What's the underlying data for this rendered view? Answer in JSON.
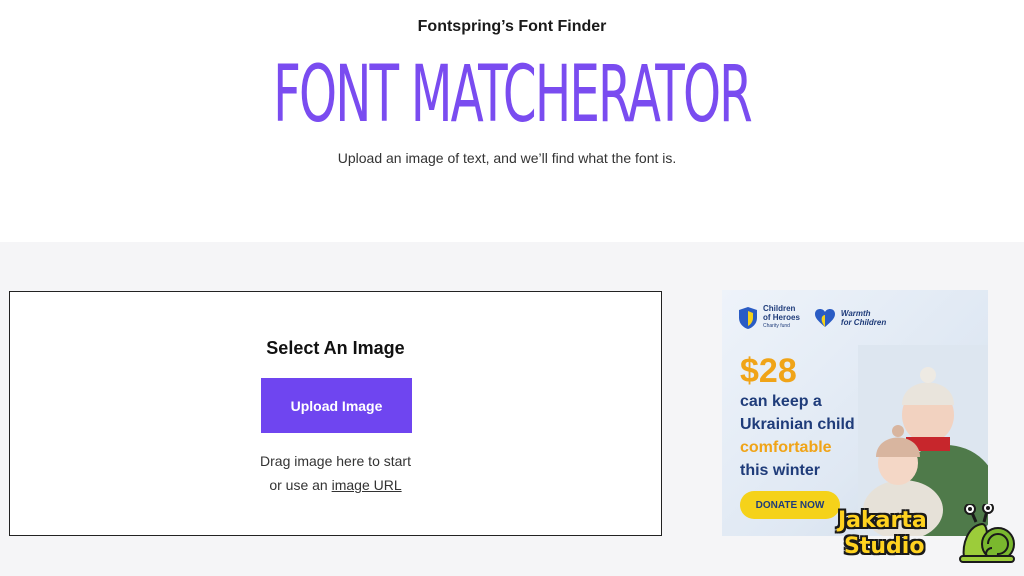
{
  "header": {
    "kicker": "Fontspring’s Font Finder",
    "title": "FONT MATCHERATOR",
    "subtitle": "Upload an image of text, and we’ll find what the font is."
  },
  "uploader": {
    "heading": "Select An Image",
    "button_label": "Upload Image",
    "hint_line1": "Drag image here to start",
    "hint_prefix": "or use an ",
    "hint_link": "image URL"
  },
  "ad": {
    "org1": [
      "Children",
      "of Heroes",
      "Charity fund"
    ],
    "org2": [
      "Warmth",
      "for Children"
    ],
    "price": "$28",
    "line1": "can keep a",
    "line2": "Ukrainian child",
    "line3": "comfortable",
    "line4": "this winter",
    "cta": "DONATE NOW"
  },
  "watermark": {
    "line1": "Jakarta",
    "line2": "Studio"
  },
  "colors": {
    "accent": "#6f45f0",
    "title": "#7a4cf0",
    "ad_blue": "#1f3c7a",
    "ad_orange": "#f0a418",
    "ad_yellow": "#f5d21a"
  }
}
